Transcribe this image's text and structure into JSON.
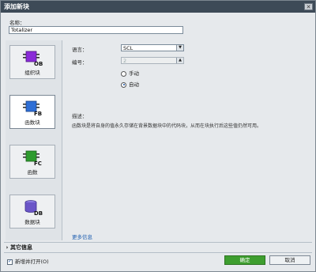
{
  "window": {
    "title": "添加新块",
    "close": "✕"
  },
  "name": {
    "label": "名称：",
    "value": "Totalizer"
  },
  "blocks": [
    {
      "code": "OB",
      "label": "组织块",
      "color": "#8a2bd8"
    },
    {
      "code": "FB",
      "label": "函数块",
      "color": "#2f6fd6",
      "selected": true
    },
    {
      "code": "FC",
      "label": "函数",
      "color": "#2e9b2e"
    },
    {
      "code": "DB",
      "label": "数据块",
      "color": "#6a55c8"
    }
  ],
  "language": {
    "label": "语言：",
    "value": "SCL"
  },
  "number": {
    "label": "编号：",
    "value": "2"
  },
  "numbering": {
    "manual": "手动",
    "auto": "自动",
    "selected": "auto"
  },
  "description": {
    "title": "描述：",
    "text": "函数块是将自身的值永久存储在背景数据块中的代码块，从而在块执行后这些值仍然可用。"
  },
  "more_info_link": "更多信息",
  "other_info": "其它信息",
  "add_open": {
    "label": "新增并打开(O)",
    "checked": true
  },
  "buttons": {
    "ok": "确定",
    "cancel": "取消"
  }
}
